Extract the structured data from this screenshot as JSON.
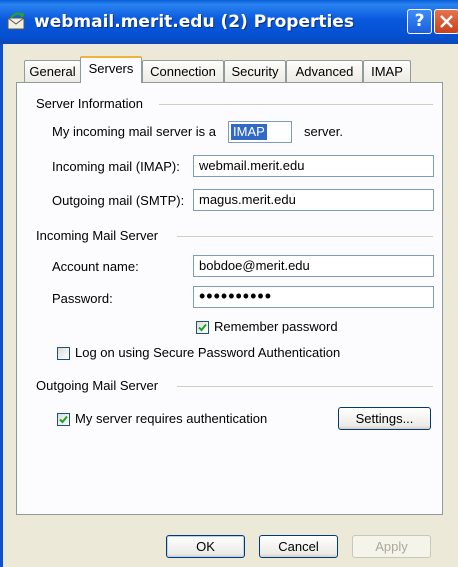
{
  "window": {
    "title": "webmail.merit.edu (2) Properties",
    "help_label": "?"
  },
  "tabs": [
    {
      "label": "General",
      "active": false
    },
    {
      "label": "Servers",
      "active": true
    },
    {
      "label": "Connection",
      "active": false
    },
    {
      "label": "Security",
      "active": false
    },
    {
      "label": "Advanced",
      "active": false
    },
    {
      "label": "IMAP",
      "active": false
    }
  ],
  "server_info": {
    "heading": "Server Information",
    "incoming_type_prefix": "My incoming mail server is a",
    "incoming_type_value": "IMAP",
    "incoming_type_suffix": "server.",
    "incoming_label": "Incoming mail (IMAP):",
    "incoming_value": "webmail.merit.edu",
    "outgoing_label": "Outgoing mail (SMTP):",
    "outgoing_value": "magus.merit.edu"
  },
  "incoming_server": {
    "heading": "Incoming Mail Server",
    "account_label": "Account name:",
    "account_value": "bobdoe@merit.edu",
    "password_label": "Password:",
    "password_value": "••••••••••",
    "remember_label": "Remember password",
    "remember_checked": true,
    "spa_label": "Log on using Secure Password Authentication",
    "spa_checked": false
  },
  "outgoing_server": {
    "heading": "Outgoing Mail Server",
    "auth_label": "My server requires authentication",
    "auth_checked": true,
    "settings_label": "Settings..."
  },
  "buttons": {
    "ok": "OK",
    "cancel": "Cancel",
    "apply": "Apply"
  },
  "colors": {
    "titlebar": "#0858dd",
    "dialog_bg": "#ece9d8",
    "tab_highlight": "#f0b43c",
    "selection": "#3169c6",
    "checkmark": "#21a121"
  }
}
